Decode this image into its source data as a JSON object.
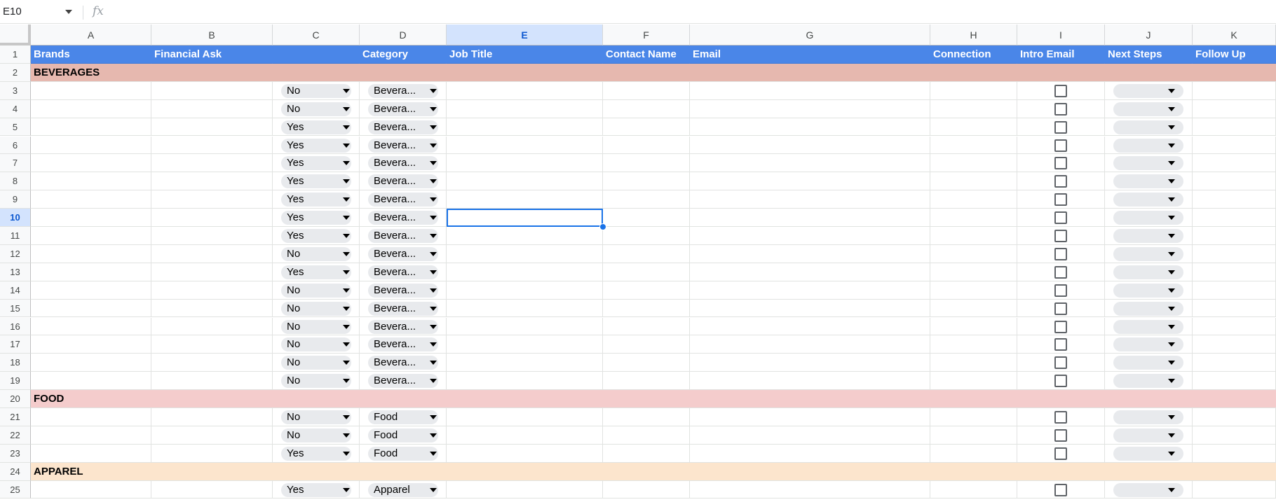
{
  "formula_bar": {
    "cell_ref": "E10",
    "fx_label": "fx"
  },
  "columns": [
    "A",
    "B",
    "C",
    "D",
    "E",
    "F",
    "G",
    "H",
    "I",
    "J",
    "K"
  ],
  "selected_column": "E",
  "selected_row": 10,
  "header_row": {
    "row_number": "1",
    "labels": [
      "Brands",
      "Financial Ask",
      "",
      "Category",
      "Job Title",
      "Contact Name",
      "Email",
      "",
      "Connection",
      "Intro Email",
      "Next Steps",
      "Follow Up"
    ]
  },
  "sections": [
    {
      "row": 2,
      "title": "BEVERAGES",
      "color": "#e6b8af"
    },
    {
      "row": 20,
      "title": "FOOD",
      "color": "#f4cccc"
    },
    {
      "row": 24,
      "title": "APPAREL",
      "color": "#fce5cd"
    }
  ],
  "data_rows": [
    {
      "row": 3,
      "ask": "No",
      "category": "Bevera..."
    },
    {
      "row": 4,
      "ask": "No",
      "category": "Bevera..."
    },
    {
      "row": 5,
      "ask": "Yes",
      "category": "Bevera..."
    },
    {
      "row": 6,
      "ask": "Yes",
      "category": "Bevera..."
    },
    {
      "row": 7,
      "ask": "Yes",
      "category": "Bevera..."
    },
    {
      "row": 8,
      "ask": "Yes",
      "category": "Bevera..."
    },
    {
      "row": 9,
      "ask": "Yes",
      "category": "Bevera..."
    },
    {
      "row": 10,
      "ask": "Yes",
      "category": "Bevera..."
    },
    {
      "row": 11,
      "ask": "Yes",
      "category": "Bevera..."
    },
    {
      "row": 12,
      "ask": "No",
      "category": "Bevera..."
    },
    {
      "row": 13,
      "ask": "Yes",
      "category": "Bevera..."
    },
    {
      "row": 14,
      "ask": "No",
      "category": "Bevera..."
    },
    {
      "row": 15,
      "ask": "No",
      "category": "Bevera..."
    },
    {
      "row": 16,
      "ask": "No",
      "category": "Bevera..."
    },
    {
      "row": 17,
      "ask": "No",
      "category": "Bevera..."
    },
    {
      "row": 18,
      "ask": "No",
      "category": "Bevera..."
    },
    {
      "row": 19,
      "ask": "No",
      "category": "Bevera..."
    },
    {
      "row": 21,
      "ask": "No",
      "category": "Food"
    },
    {
      "row": 22,
      "ask": "No",
      "category": "Food"
    },
    {
      "row": 23,
      "ask": "Yes",
      "category": "Food"
    },
    {
      "row": 25,
      "ask": "Yes",
      "category": "Apparel"
    }
  ],
  "colors": {
    "header_blue": "#4a86e8",
    "selection": "#1a73e8",
    "chip": "#e8eaed"
  }
}
